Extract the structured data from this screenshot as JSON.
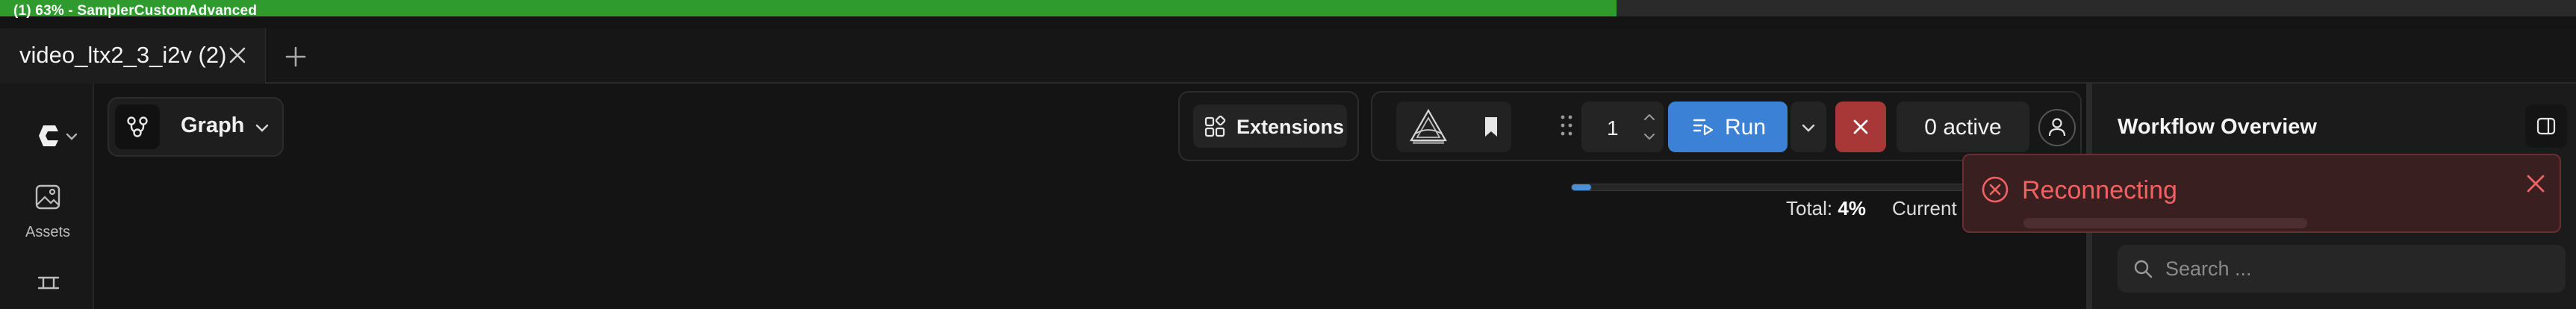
{
  "progress_strip": {
    "label": "(1) 63% - SamplerCustomAdvanced",
    "fraction": 0.63,
    "color": "#2f9b2f"
  },
  "tabs": [
    {
      "label": "video_ltx2_3_i2v (2)"
    }
  ],
  "icons": {
    "tab_close": "close-icon",
    "new_tab": "plus-icon",
    "logo": "comfy-logo-icon",
    "assets": "image-icon",
    "rail_more": "nodes-icon",
    "graph": "workflow-graph-icon",
    "extensions": "puzzle-icon",
    "bookmark": "bookmark-icon",
    "run": "queue-run-icon",
    "cancel": "close-icon",
    "user": "user-icon",
    "panel_toggle": "sidebar-toggle-icon",
    "search": "search-icon",
    "toast": "error-circle-icon"
  },
  "left_rail": {
    "assets_label": "Assets"
  },
  "graph_selector": {
    "label": "Graph"
  },
  "extensions": {
    "label": "Extensions"
  },
  "run_toolbar": {
    "count": "1",
    "run_label": "Run",
    "active_label": "0 active",
    "accent": "#3b82d6",
    "cancel_color": "#a83838"
  },
  "queue_progress": {
    "total_label": "Total:",
    "total_value": "4%",
    "total_fraction": 0.04,
    "current_label": "Current"
  },
  "right_panel": {
    "title": "Workflow Overview",
    "search_placeholder": "Search ..."
  },
  "toast": {
    "message": "Reconnecting",
    "color": "#f06262"
  }
}
